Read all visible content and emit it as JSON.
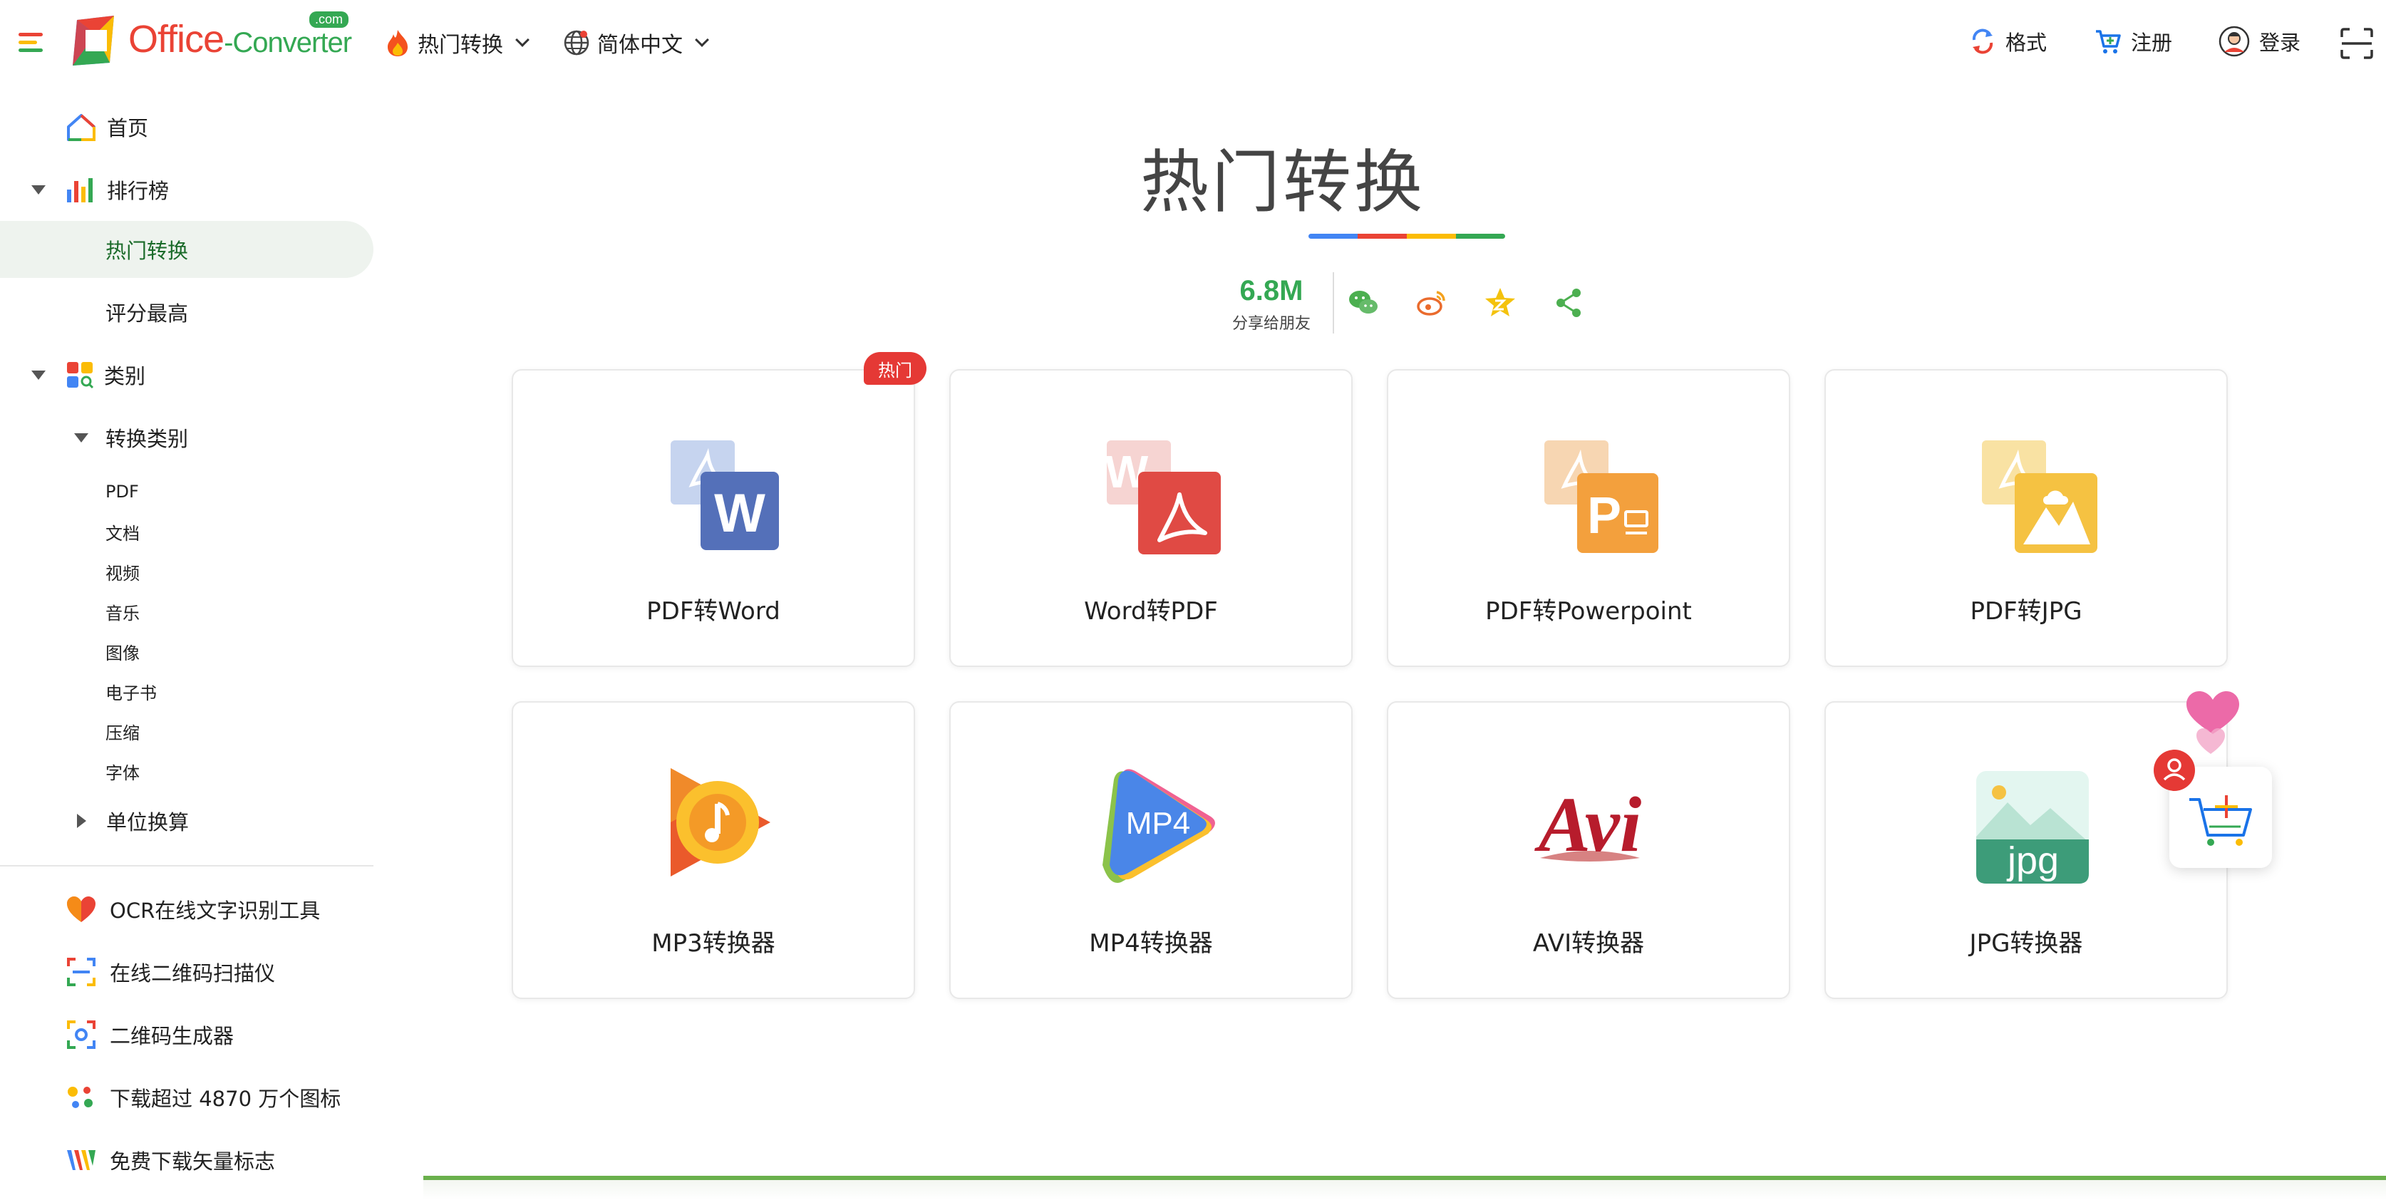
{
  "header": {
    "brand_office": "Office",
    "brand_converter": "-Converter",
    "brand_com": ".com",
    "nav": [
      {
        "label": "热门转换",
        "icon": "flame-icon"
      },
      {
        "label": "简体中文",
        "icon": "globe-icon"
      }
    ],
    "right": [
      {
        "label": "格式",
        "icon": "convert-arrows-icon"
      },
      {
        "label": "注册",
        "icon": "cart-icon"
      },
      {
        "label": "登录",
        "icon": "user-avatar-icon"
      }
    ]
  },
  "sidebar": {
    "items": [
      {
        "label": "首页",
        "icon": "home-icon"
      },
      {
        "label": "排行榜",
        "icon": "bar-chart-icon"
      },
      {
        "label": "热门转换"
      },
      {
        "label": "评分最高"
      },
      {
        "label": "类别",
        "icon": "category-icon"
      },
      {
        "label": "转换类别"
      }
    ],
    "categories": [
      "PDF",
      "文档",
      "视频",
      "音乐",
      "图像",
      "电子书",
      "压缩",
      "字体"
    ],
    "unit_conversion": "单位换算",
    "tools": [
      {
        "label": "OCR在线文字识别工具",
        "icon": "heart-icon"
      },
      {
        "label": "在线二维码扫描仪",
        "icon": "qr-scan-icon"
      },
      {
        "label": "二维码生成器",
        "icon": "qr-generator-icon"
      },
      {
        "label": "下载超过 4870 万个图标",
        "icon": "dots-icon"
      },
      {
        "label": "免费下载矢量标志",
        "icon": "vector-logo-icon"
      }
    ]
  },
  "main": {
    "title": "热门转换",
    "title_bar_colors": [
      "#4285f4",
      "#ea4335",
      "#fbbc05",
      "#34a853"
    ],
    "share_count": "6.8M",
    "share_label": "分享给朋友",
    "share_icons": [
      "wechat-icon",
      "weibo-icon",
      "favorite-star-icon",
      "share-icon"
    ],
    "hot_badge": "热门",
    "cards": [
      {
        "label": "PDF转Word",
        "icon": "pdf-to-word-icon"
      },
      {
        "label": "Word转PDF",
        "icon": "word-to-pdf-icon"
      },
      {
        "label": "PDF转Powerpoint",
        "icon": "pdf-to-powerpoint-icon"
      },
      {
        "label": "PDF转JPG",
        "icon": "pdf-to-jpg-icon"
      },
      {
        "label": "MP3转换器",
        "icon": "mp3-converter-icon"
      },
      {
        "label": "MP4转换器",
        "icon": "mp4-converter-icon",
        "icon_text": "MP4"
      },
      {
        "label": "AVI转换器",
        "icon": "avi-converter-icon",
        "icon_text": "Avi"
      },
      {
        "label": "JPG转换器",
        "icon": "jpg-converter-icon",
        "icon_text": "jpg"
      }
    ]
  },
  "colors": {
    "red": "#ea4335",
    "green": "#34a853",
    "yellow": "#fbbc05",
    "blue": "#4285f4",
    "active_bg": "#eef3ee"
  }
}
